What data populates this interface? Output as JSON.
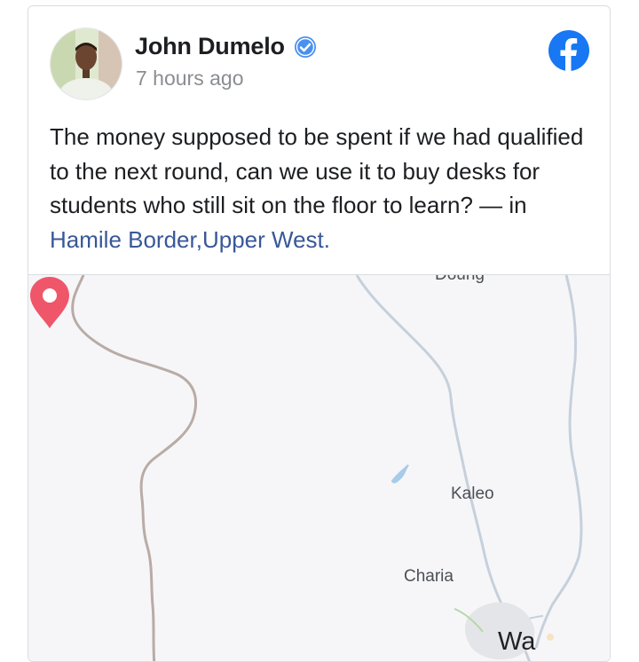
{
  "post": {
    "author": "John Dumelo",
    "verified_icon": "verified-badge-icon",
    "timestamp": "7 hours ago",
    "platform_icon": "facebook-icon",
    "text": "The money supposed to be spent if we had qualified to the next round, can we use it to buy desks for students who still sit on the floor to learn?",
    "location_prefix": " — in ",
    "location": "Hamile Border,Upper West",
    "location_suffix": "."
  },
  "map": {
    "labels": {
      "top": "Doung",
      "pin_place": "Kaleo",
      "charia": "Charia",
      "city": "Wa"
    },
    "pin_icon": "map-pin-icon",
    "colors": {
      "background": "#f6f6f8",
      "border_line": "#b8a9a5",
      "road": "#c6d0dc",
      "water": "#a8cce8",
      "pin": "#f0566a"
    }
  },
  "colors": {
    "facebook_blue": "#1877f2",
    "link": "#385898",
    "text": "#1c1e21",
    "muted": "#8a8d91"
  }
}
